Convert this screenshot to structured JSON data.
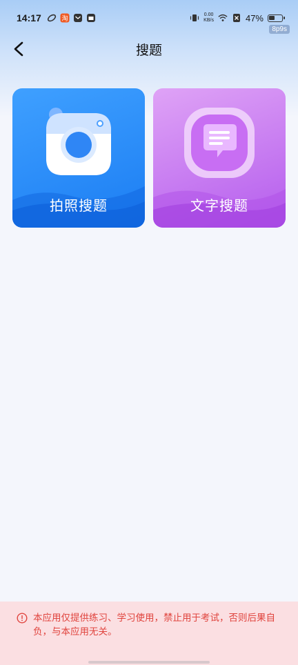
{
  "status_bar": {
    "time": "14:17",
    "net_speed_value": "0.00",
    "net_speed_unit": "KB/s",
    "battery_percent": "47%",
    "battery_level": 0.47,
    "corner_tag": "8p9s"
  },
  "header": {
    "title": "搜题",
    "back_icon": "chevron-left-icon"
  },
  "cards": [
    {
      "label": "拍照搜题",
      "icon": "camera-icon",
      "color": "#1b7df3"
    },
    {
      "label": "文字搜题",
      "icon": "chat-bubble-icon",
      "color": "#b45ced"
    }
  ],
  "notice": {
    "icon": "alert-circle-icon",
    "text": "本应用仅提供练习、学习使用，禁止用于考试，否则后果自负，与本应用无关。",
    "color": "#e0443e"
  }
}
